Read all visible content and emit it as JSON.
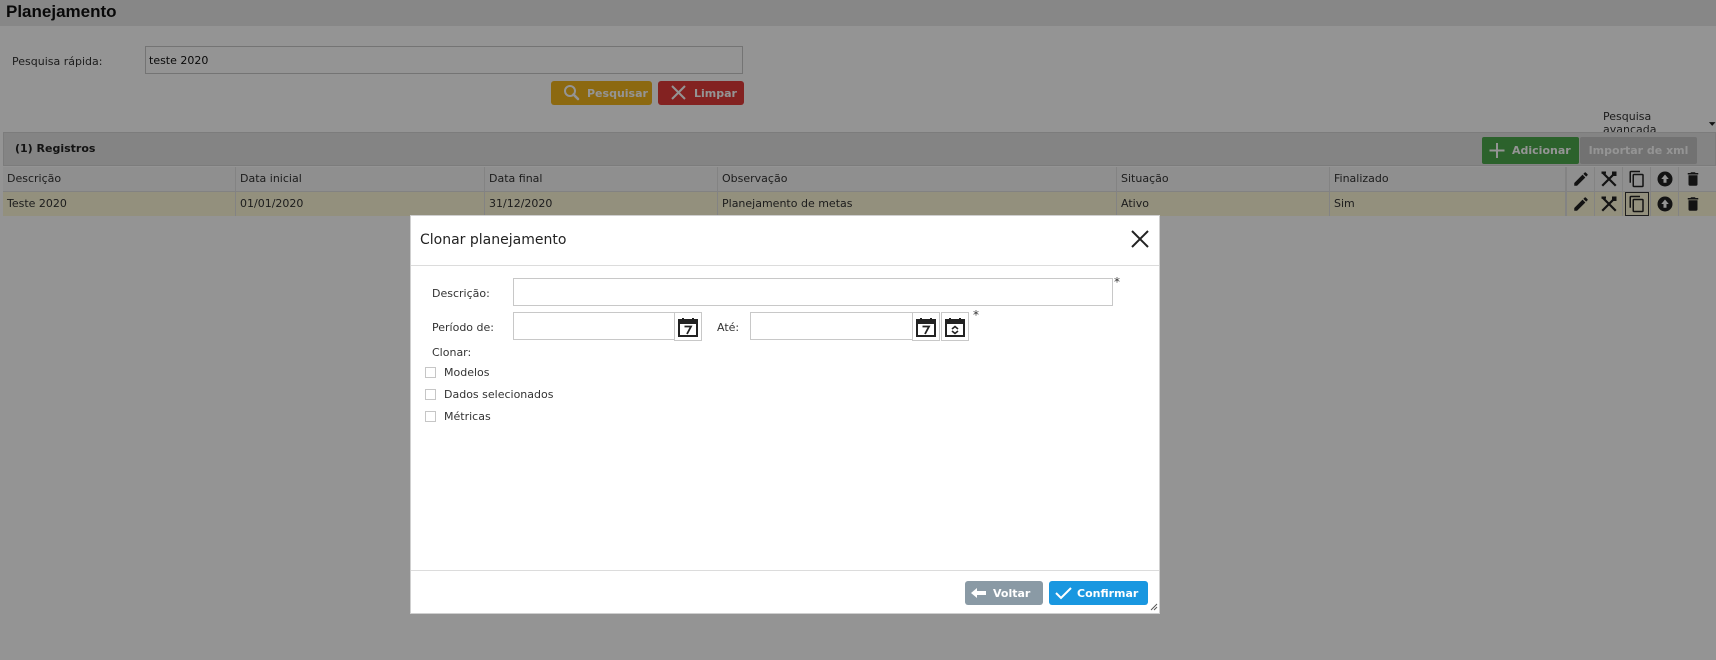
{
  "page": {
    "title": "Planejamento"
  },
  "quick_search": {
    "label": "Pesquisa rápida:",
    "value": "teste 2020",
    "search_button": "Pesquisar",
    "clear_button": "Limpar"
  },
  "advanced_search": {
    "label": "Pesquisa avançada"
  },
  "records": {
    "title": "(1) Registros",
    "add_button": "Adicionar",
    "import_button": "Importar de xml"
  },
  "grid": {
    "columns": [
      "Descrição",
      "Data inicial",
      "Data final",
      "Observação",
      "Situação",
      "Finalizado"
    ],
    "rows": [
      [
        "Teste 2020",
        "01/01/2020",
        "31/12/2020",
        "Planejamento de metas",
        "Ativo",
        "Sim"
      ]
    ],
    "action_icons": [
      "edit-icon",
      "tools-icon",
      "copy-icon",
      "upload-icon",
      "trash-icon"
    ]
  },
  "modal": {
    "title": "Clonar planejamento",
    "description_label": "Descrição:",
    "period_from_label": "Período de:",
    "period_to_label": "Até:",
    "required_mark": "*",
    "clone_label": "Clonar:",
    "options": [
      {
        "label": "Modelos",
        "checked": false
      },
      {
        "label": "Dados selecionados",
        "checked": false
      },
      {
        "label": "Métricas",
        "checked": false
      }
    ],
    "back_button": "Voltar",
    "confirm_button": "Confirmar"
  },
  "colors": {
    "search_button": "#f1b51c",
    "clear_button": "#e23c39",
    "add_button": "#4caa4c",
    "import_button": "#c4c4c4",
    "back_button": "#8a9aa5",
    "confirm_button": "#1997e0",
    "selected_row": "#fdf8d8"
  }
}
